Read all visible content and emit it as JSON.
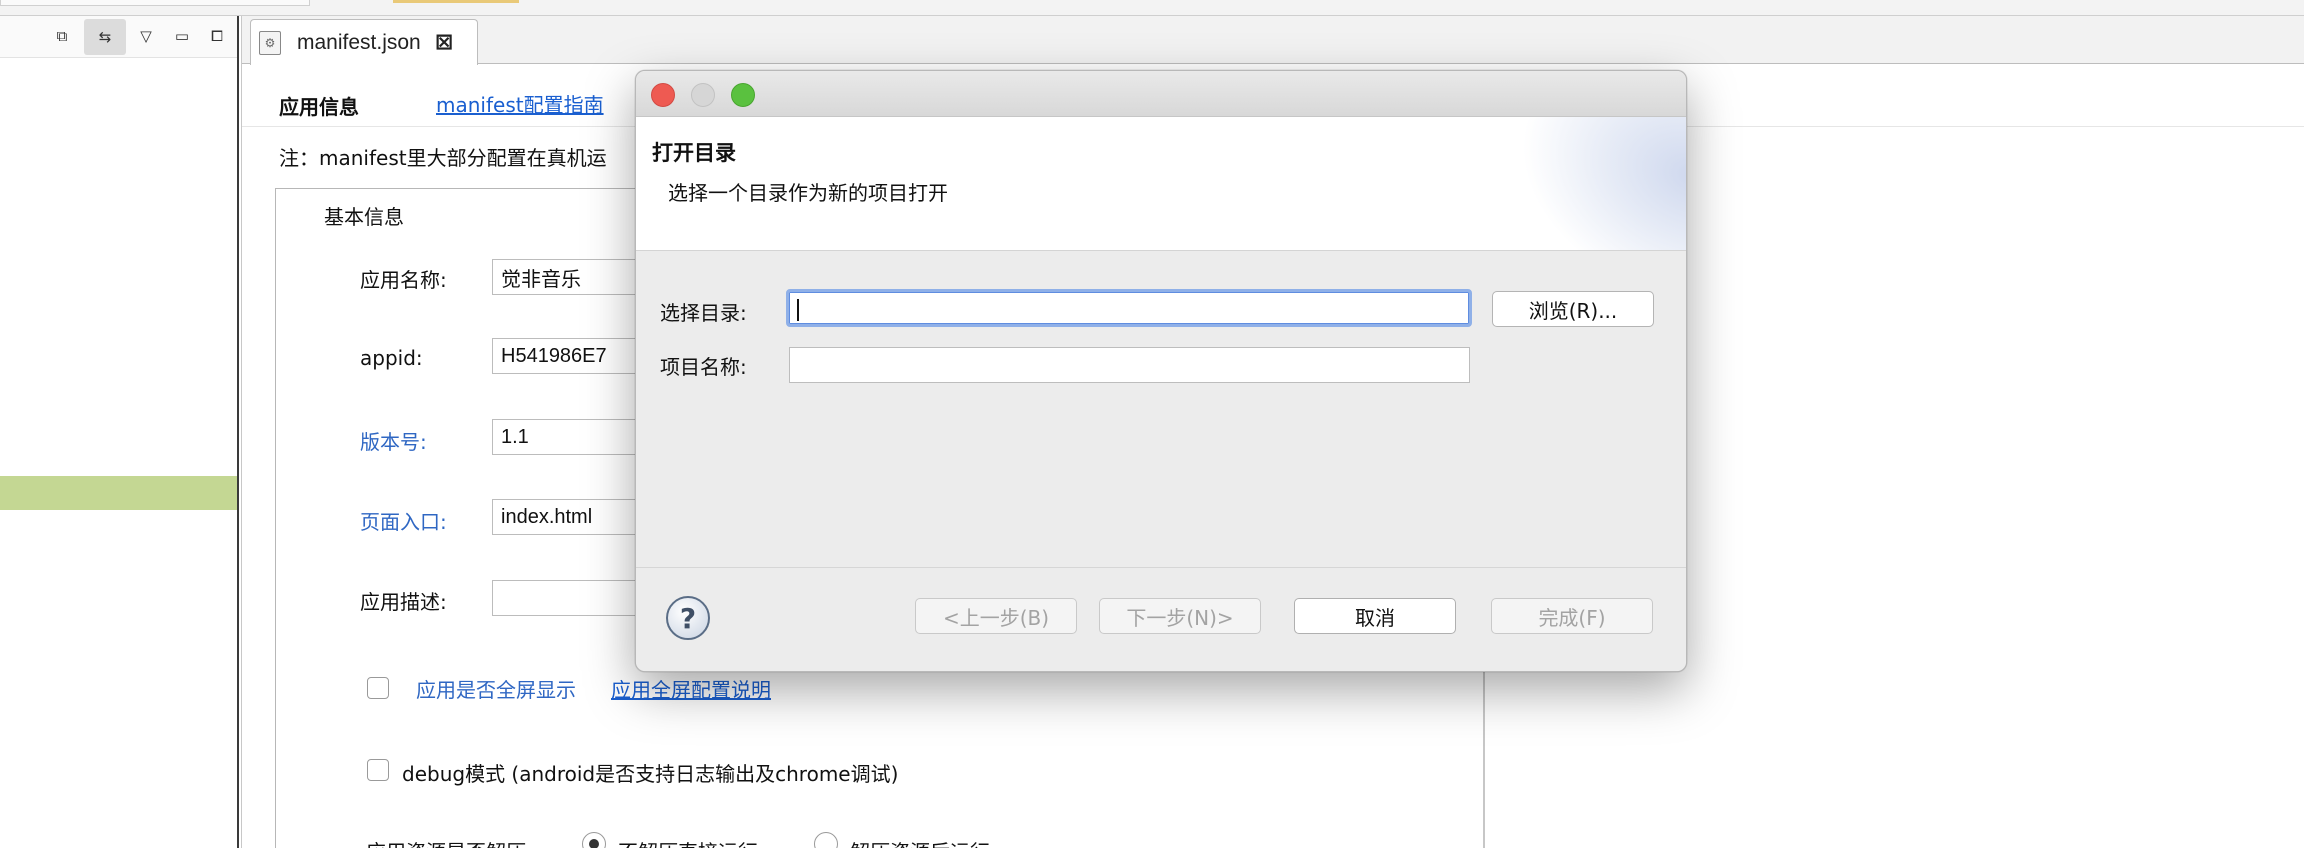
{
  "editor": {
    "tab_title": "manifest.json",
    "nav": {
      "app_info": "应用信息",
      "guide_link": "manifest配置指南"
    },
    "note": "注：manifest里大部分配置在真机运",
    "basic": {
      "section_title": "基本信息",
      "app_name_label": "应用名称:",
      "app_name_value": "觉非音乐",
      "appid_label": "appid:",
      "appid_value": "H541986E7",
      "version_label": "版本号:",
      "version_value": "1.1",
      "entry_label": "页面入口:",
      "entry_value": "index.html",
      "desc_label": "应用描述:",
      "desc_value": "",
      "fullscreen_text": "应用是否全屏显示",
      "fullscreen_link": "应用全屏配置说明",
      "debug_text": "debug模式 (android是否支持日志输出及chrome调试)",
      "resource_label": "应用资源是否解压",
      "radio_no_unzip": "不解压直接运行",
      "radio_unzip": "解压资源后运行"
    }
  },
  "dialog": {
    "title": "打开目录",
    "subtitle": "选择一个目录作为新的项目打开",
    "dir_label": "选择目录:",
    "dir_value": "",
    "browse_button": "浏览(R)...",
    "name_label": "项目名称:",
    "name_value": "",
    "help_symbol": "?",
    "buttons": {
      "prev": "<上一步(B)",
      "next": "下一步(N)>",
      "cancel": "取消",
      "finish": "完成(F)"
    }
  },
  "colors": {
    "link_blue": "#1a5fd0",
    "label_blue": "#2f67c3",
    "tree_highlight": "#c4d793",
    "focus_ring": "#8fb0e8"
  },
  "icons": {
    "left_toolbar": [
      "restore-icon",
      "link-editor-icon",
      "view-menu-icon",
      "minimize-icon",
      "maximize-icon"
    ],
    "tab": "json-file-icon",
    "tab_close": "close-icon"
  }
}
